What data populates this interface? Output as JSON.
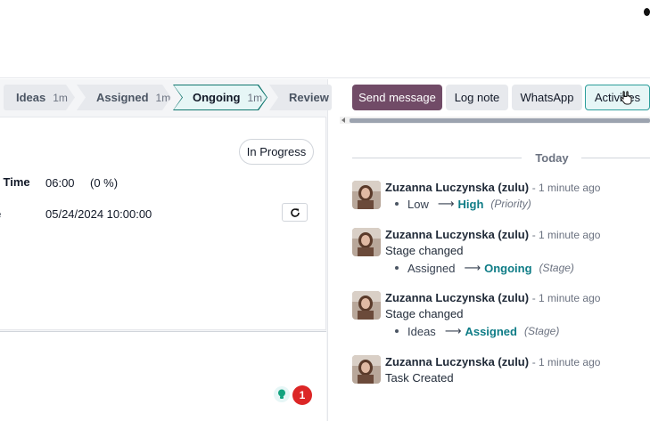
{
  "stages": [
    {
      "label": "Ideas",
      "duration": "1m"
    },
    {
      "label": "Assigned",
      "duration": "1m"
    },
    {
      "label": "Ongoing",
      "duration": "1m"
    },
    {
      "label": "Review",
      "duration": ""
    }
  ],
  "form": {
    "status": "In Progress",
    "fields": [
      {
        "label": "d Time",
        "value": "06:00",
        "extra": "(0 %)"
      },
      {
        "label": "e",
        "value": "05/24/2024 10:00:00"
      }
    ],
    "activity_count": "1"
  },
  "chatter": {
    "send_message": "Send message",
    "log_note": "Log note",
    "whatsapp": "WhatsApp",
    "activities": "Activities",
    "today": "Today",
    "messages": [
      {
        "author": "Zuzanna Luczynska (zulu)",
        "time": "- 1 minute ago",
        "body": "",
        "change": {
          "old": "Low",
          "new": "High",
          "field": "(Priority)"
        }
      },
      {
        "author": "Zuzanna Luczynska (zulu)",
        "time": "- 1 minute ago",
        "body": "Stage changed",
        "change": {
          "old": "Assigned",
          "new": "Ongoing",
          "field": "(Stage)"
        }
      },
      {
        "author": "Zuzanna Luczynska (zulu)",
        "time": "- 1 minute ago",
        "body": "Stage changed",
        "change": {
          "old": "Ideas",
          "new": "Assigned",
          "field": "(Stage)"
        }
      },
      {
        "author": "Zuzanna Luczynska (zulu)",
        "time": "- 1 minute ago",
        "body": "Task Created"
      }
    ]
  },
  "colors": {
    "primary": "#714b67",
    "accent": "#0e7c86",
    "danger": "#dc2626"
  },
  "icons": [
    "refresh-icon",
    "lightbulb-icon",
    "hand-cursor-icon",
    "arrow-right-icon"
  ]
}
